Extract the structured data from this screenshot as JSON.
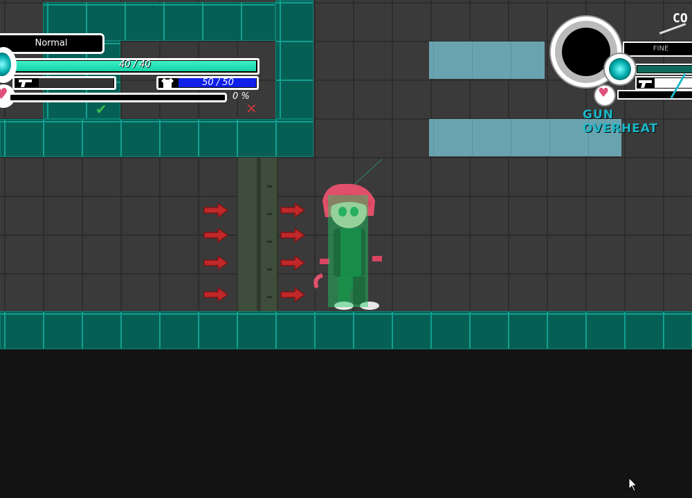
{
  "player_hud": {
    "mode_label": "Normal",
    "hp_text": "40 / 40",
    "hp_fraction": 1.0,
    "armor_text": "50 / 50",
    "armor_fraction": 1.0,
    "lust_percent_text": "0 %",
    "lust_fraction": 0.0,
    "weapon_icon": "pistol-icon",
    "armor_icon": "shirt-icon",
    "heart_icon": "heart-icon",
    "confirm_icon": "checkmark-icon",
    "cancel_icon": "cross-icon"
  },
  "enemy_hud": {
    "title_fragment": "CO",
    "status_text": "FINE",
    "warning_text": "GUN OVERHEAT",
    "weapon_icon": "pistol-icon",
    "heart_icon": "heart-icon"
  },
  "colors": {
    "tile_teal": "#065f55",
    "tile_edge": "#13a091",
    "hp_green": "#3ff0c8",
    "armor_blue": "#1020e8",
    "heart_pink": "#e0507a",
    "arrow_red": "#c0282a",
    "overheat_cyan": "#1bb8c8",
    "ghost_block": "#6aa3b0"
  }
}
